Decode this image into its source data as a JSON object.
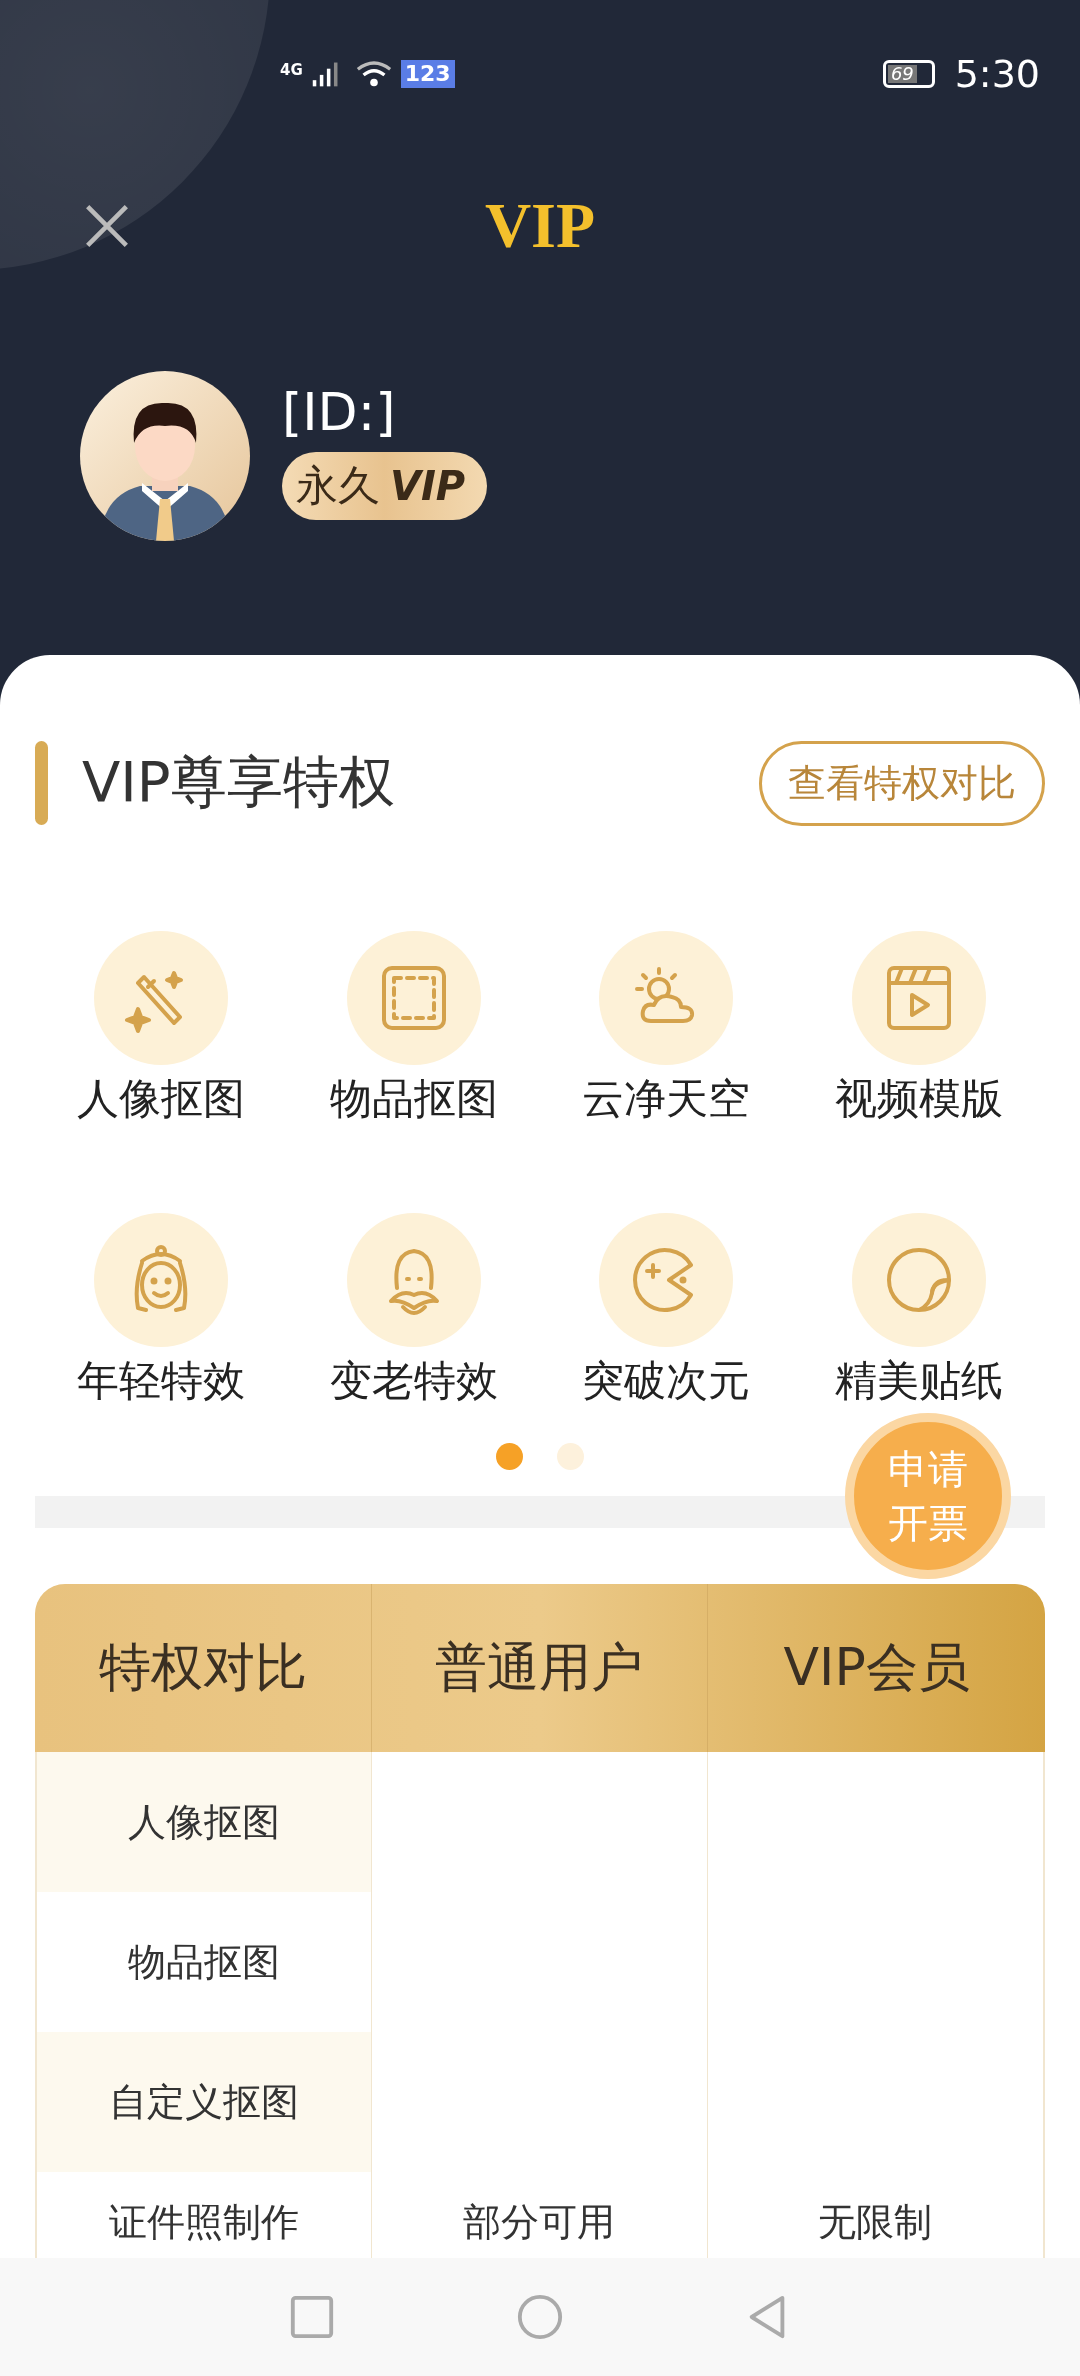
{
  "status_bar": {
    "network": "4G",
    "input_badge": "123",
    "battery": "69",
    "time": "5:30"
  },
  "header": {
    "title": "VIP",
    "user_id": "[ID:]",
    "badge_text": "永久",
    "badge_vip": "VIP"
  },
  "privileges": {
    "title": "VIP尊享特权",
    "compare_button": "查看特权对比",
    "items": [
      {
        "label": "人像抠图",
        "kind": "wand"
      },
      {
        "label": "物品抠图",
        "kind": "frame"
      },
      {
        "label": "云净天空",
        "kind": "weather"
      },
      {
        "label": "视频模版",
        "kind": "clapper"
      },
      {
        "label": "年轻特效",
        "kind": "girl"
      },
      {
        "label": "变老特效",
        "kind": "oldman"
      },
      {
        "label": "突破次元",
        "kind": "pacman"
      },
      {
        "label": "精美贴纸",
        "kind": "sticker"
      }
    ],
    "page_dots": [
      {
        "selected": true
      },
      {
        "selected": false
      }
    ]
  },
  "invoice_button": "申请开票",
  "comparison": {
    "columns": [
      "特权对比",
      "普通用户",
      "VIP会员"
    ],
    "rows": [
      {
        "feature": "人像抠图",
        "shaded": true
      },
      {
        "feature": "物品抠图",
        "shaded": false
      },
      {
        "feature": "自定义抠图",
        "shaded": true
      },
      {
        "feature": "证件照制作",
        "normal": "部分可用",
        "vip": "无限制",
        "shaded": false
      }
    ]
  }
}
